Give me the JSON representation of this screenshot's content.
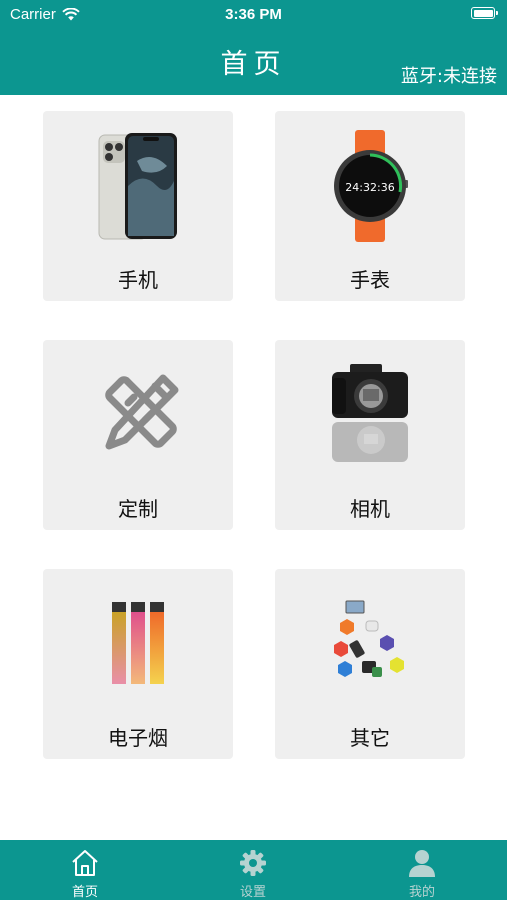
{
  "status_bar": {
    "carrier": "Carrier",
    "time": "3:36 PM"
  },
  "header": {
    "title": "首页",
    "bluetooth_status": "蓝牙:未连接"
  },
  "categories": [
    {
      "label": "手机",
      "icon": "phone-image"
    },
    {
      "label": "手表",
      "icon": "watch-image"
    },
    {
      "label": "定制",
      "icon": "pencil-ruler-icon"
    },
    {
      "label": "相机",
      "icon": "camera-image"
    },
    {
      "label": "电子烟",
      "icon": "e-cigarette-image"
    },
    {
      "label": "其它",
      "icon": "other-devices-image"
    }
  ],
  "watch_display": "24:32:36",
  "tabs": [
    {
      "label": "首页",
      "icon": "home-icon",
      "active": true
    },
    {
      "label": "设置",
      "icon": "gear-icon",
      "active": false
    },
    {
      "label": "我的",
      "icon": "user-icon",
      "active": false
    }
  ],
  "colors": {
    "primary": "#0c9690",
    "card": "#efefef",
    "tab_inactive": "#b6d3d1"
  }
}
